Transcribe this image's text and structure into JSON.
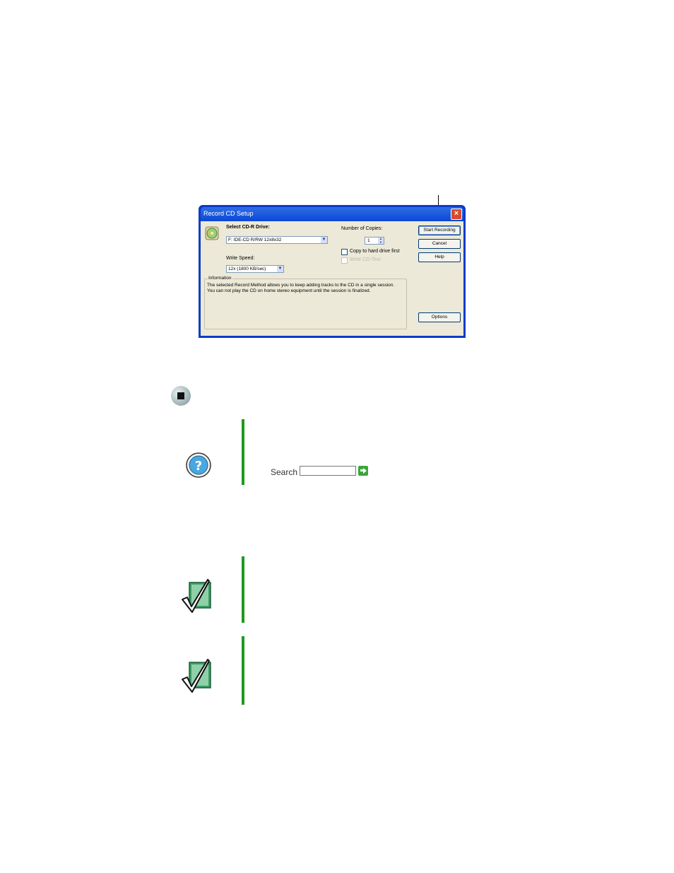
{
  "dialog": {
    "title": "Record CD Setup",
    "close_symbol": "×",
    "select_drive_label": "Select CD-R Drive:",
    "drive_value": "F: IDE-CD R/RW 12x8x32",
    "write_speed_label": "Write Speed:",
    "speed_value": "12x (1800 KB/sec)",
    "copies_label": "Number of Copies:",
    "copies_value": "1",
    "copy_to_hard_drive_label": "Copy to hard drive first",
    "write_cd_text_label": "Write CD-Text",
    "information_label": "Information",
    "information_text": "The selected Record Method allows you to keep adding tracks to the CD in a single session. You can not play the CD on home stereo equipment until the session is finalized.",
    "buttons": {
      "start_recording": "Start Recording",
      "cancel": "Cancel",
      "help": "Help",
      "options": "Options"
    }
  },
  "help_box": {
    "icon": "help-question-icon",
    "search_label": "Search",
    "search_value": ""
  },
  "notes": [
    {
      "icon": "checkmark-note-icon"
    },
    {
      "icon": "checkmark-note-icon"
    }
  ],
  "colors": {
    "accent_bar": "#1e9a1e",
    "titlebar": "#0a47d6",
    "dialog_face": "#ece9d8"
  }
}
